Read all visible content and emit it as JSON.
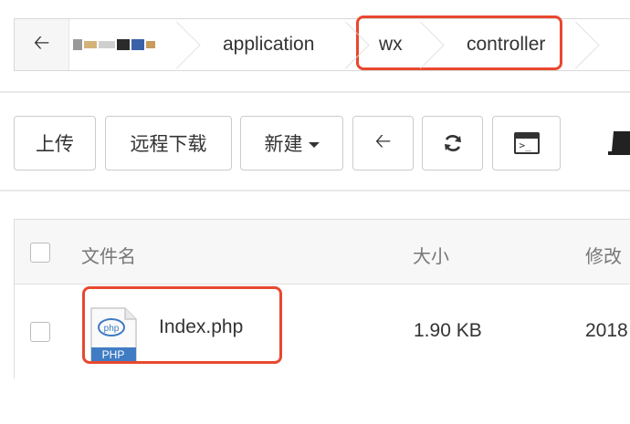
{
  "breadcrumb": {
    "items": [
      {
        "label": "application"
      },
      {
        "label": "wx"
      },
      {
        "label": "controller"
      }
    ]
  },
  "toolbar": {
    "upload_label": "上传",
    "remote_download_label": "远程下载",
    "new_label": "新建"
  },
  "table": {
    "headers": {
      "name": "文件名",
      "size": "大小",
      "modified": "修改"
    },
    "rows": [
      {
        "name": "Index.php",
        "size": "1.90 KB",
        "modified": "2018",
        "icon_label": "PHP",
        "icon_badge": "php"
      }
    ]
  },
  "colors": {
    "highlight": "#e8482f",
    "php_blue": "#3f7cc4"
  }
}
